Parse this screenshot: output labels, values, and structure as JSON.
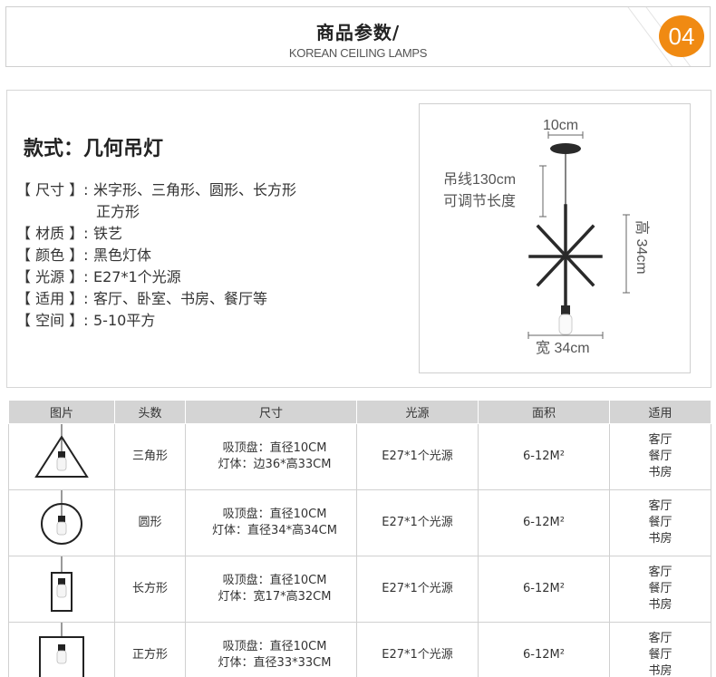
{
  "header": {
    "title": "商品参数/",
    "subtitle": "KOREAN CEILING LAMPS",
    "badge": "04"
  },
  "spec": {
    "style_title": "款式：几何吊灯",
    "items": [
      {
        "label": "【 尺寸 】:",
        "value": "米字形、三角形、圆形、长方形",
        "value_cont": "正方形"
      },
      {
        "label": "【 材质 】:",
        "value": "铁艺"
      },
      {
        "label": "【 颜色 】:",
        "value": "黑色灯体"
      },
      {
        "label": "【 光源 】:",
        "value": "E27*1个光源"
      },
      {
        "label": "【 适用 】:",
        "value": "客厅、卧室、书房、餐厅等"
      },
      {
        "label": "【 空间 】:",
        "value": "5-10平方"
      }
    ]
  },
  "diagram": {
    "top_width": "10cm",
    "cord_line1": "吊线130cm",
    "cord_line2": "可调节长度",
    "height": "高 34cm",
    "width": "宽 34cm"
  },
  "table": {
    "headers": [
      "图片",
      "头数",
      "尺寸",
      "光源",
      "面积",
      "适用"
    ],
    "rows": [
      {
        "shape": "三角形",
        "shape_icon": "triangle-lamp-icon",
        "size1": "吸顶盘：直径10CM",
        "size2": "灯体：边36*高33CM",
        "light": "E27*1个光源",
        "area": "6-12M²",
        "usage": [
          "客厅",
          "餐厅",
          "书房"
        ]
      },
      {
        "shape": "圆形",
        "shape_icon": "circle-lamp-icon",
        "size1": "吸顶盘：直径10CM",
        "size2": "灯体：直径34*高34CM",
        "light": "E27*1个光源",
        "area": "6-12M²",
        "usage": [
          "客厅",
          "餐厅",
          "书房"
        ]
      },
      {
        "shape": "长方形",
        "shape_icon": "rectangle-lamp-icon",
        "size1": "吸顶盘：直径10CM",
        "size2": "灯体：宽17*高32CM",
        "light": "E27*1个光源",
        "area": "6-12M²",
        "usage": [
          "客厅",
          "餐厅",
          "书房"
        ]
      },
      {
        "shape": "正方形",
        "shape_icon": "square-lamp-icon",
        "size1": "吸顶盘：直径10CM",
        "size2": "灯体：直径33*33CM",
        "light": "E27*1个光源",
        "area": "6-12M²",
        "usage": [
          "客厅",
          "餐厅",
          "书房"
        ]
      }
    ]
  },
  "colors": {
    "accent": "#f08a12",
    "table_header": "#d4d4d4"
  }
}
